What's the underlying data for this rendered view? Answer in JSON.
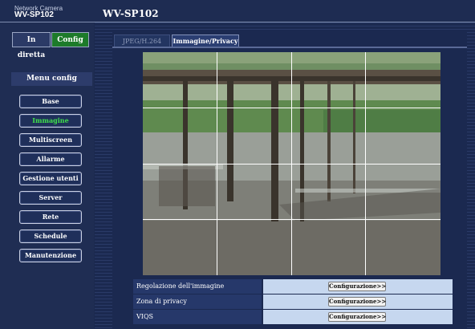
{
  "header": {
    "brand_small": "Network Camera",
    "brand_model": "WV-SP102",
    "page_title": "WV-SP102"
  },
  "modes": {
    "live_label": "In diretta",
    "config_label": "Config"
  },
  "sidebar": {
    "title": "Menu config",
    "items": [
      {
        "label": "Base"
      },
      {
        "label": "Immagine"
      },
      {
        "label": "Multiscreen"
      },
      {
        "label": "Allarme"
      },
      {
        "label": "Gestione utenti"
      },
      {
        "label": "Server"
      },
      {
        "label": "Rete"
      },
      {
        "label": "Schedule"
      },
      {
        "label": "Manutenzione"
      }
    ],
    "active_item": "Immagine"
  },
  "tabs": [
    {
      "label": "JPEG/H.264"
    },
    {
      "label": "Immagine/Privacy"
    }
  ],
  "active_tab": "Immagine/Privacy",
  "settings": [
    {
      "label": "Regolazione dell'immagine",
      "button": "Configurazione>>"
    },
    {
      "label": "Zona di privacy",
      "button": "Configurazione>>"
    },
    {
      "label": "VIQS",
      "button": "Configurazione>>"
    }
  ],
  "colors": {
    "config_active": "#1d7b2a",
    "active_menu_text": "#3fe04b",
    "panel_bg": "#1b2950"
  }
}
